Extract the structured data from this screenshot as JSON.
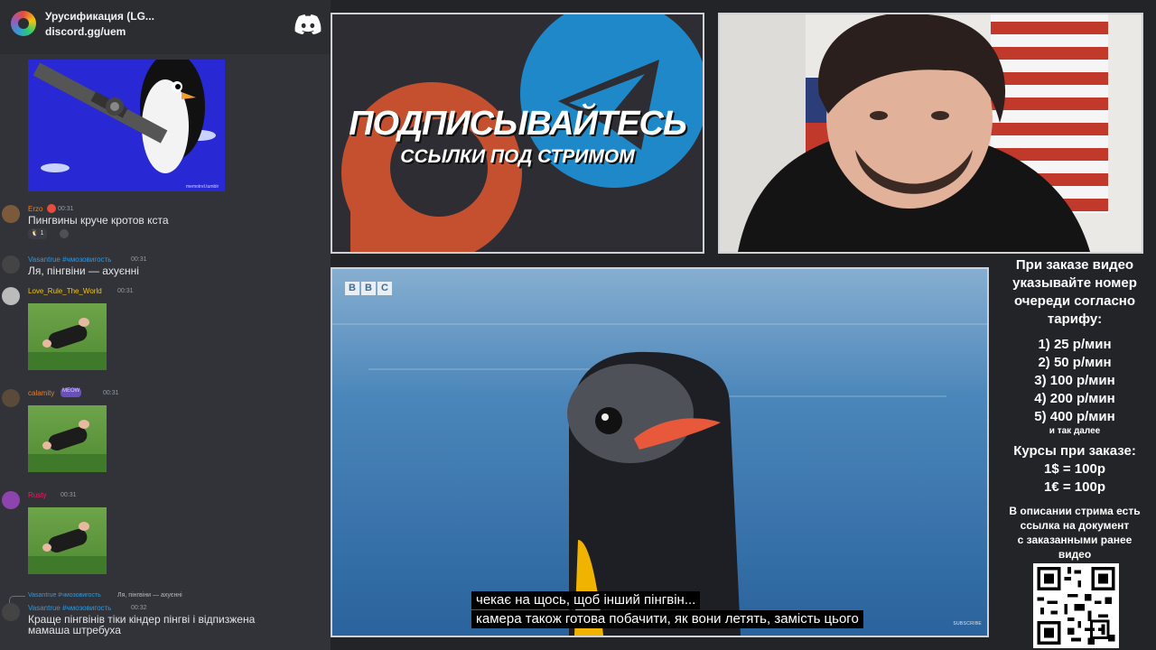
{
  "server": {
    "name": "Урусификация (LG...",
    "invite": "discord.gg/uem",
    "logo_icon": "discord-logo-icon"
  },
  "chat": {
    "messages": [
      {
        "user": "Erzo",
        "time": "00:31",
        "text": "Пингвины круче кротов кста",
        "user_color": "#e67e22",
        "reaction_count": "1"
      },
      {
        "user": "Vasantrue #чмозовигость",
        "time": "00:31",
        "text": "Ля, пінгвіни — ахуєнні",
        "user_color": "#3498db"
      },
      {
        "user": "Love_Rule_The_World",
        "time": "00:31",
        "user_color": "#f1c40f"
      },
      {
        "user": "calamity",
        "badge": "MEOW",
        "time": "00:31",
        "user_color": "#e67e22"
      },
      {
        "user": "Rusty",
        "time": "00:31",
        "user_color": "#e91e63"
      },
      {
        "reply_user": "Vasantrue #чмозовигость",
        "reply_text": "Ля, пінгвіни — ахуєнні",
        "user": "Vasantrue #чмозовигость",
        "time": "00:32",
        "text_line1": "Краще пінгвінів тіки кіндер пінгві і відпизжена",
        "text_line2": "мамаша штребуха",
        "user_color": "#3498db"
      }
    ],
    "image_caption": "memotrel.tumblr"
  },
  "promo": {
    "title": "ПОДПИСЫВАЙТЕСЬ",
    "subtitle": "ССЫЛКИ ПОД СТРИМОМ"
  },
  "video": {
    "broadcaster": [
      "B",
      "B",
      "C"
    ],
    "subtitle_line1": "чекає на щось, щоб інший пінгвін...",
    "subtitle_line2": "камера також готова побачити, як вони летять, замість цього",
    "subscribe_tag": "SUBSCRIBE"
  },
  "info": {
    "intro": [
      "При заказе видео",
      "указывайте номер",
      "очереди согласно",
      "тарифу:"
    ],
    "prices": [
      "1) 25 р/мин",
      "2) 50 р/мин",
      "3) 100 р/мин",
      "4) 200 р/мин",
      "5) 400 р/мин"
    ],
    "prices_more": "и так далее",
    "rates_title": "Курсы при заказе:",
    "rates": [
      "1$ = 100р",
      "1€ = 100р"
    ],
    "doc_note": [
      "В описании стрима есть",
      "ссылка на документ",
      "с заказанными ранее",
      "видео"
    ]
  }
}
